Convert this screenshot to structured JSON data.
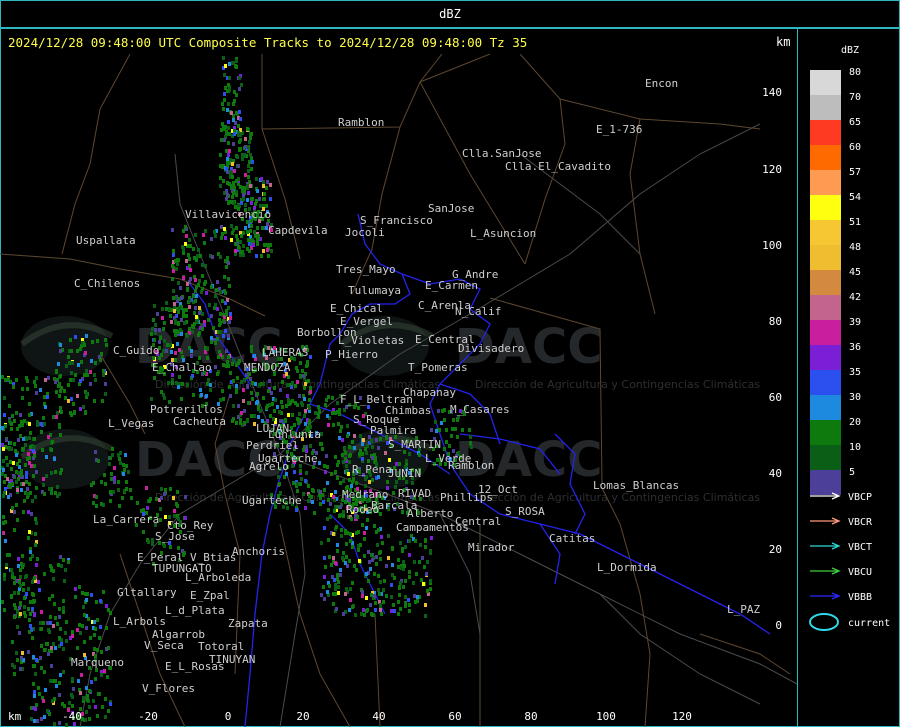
{
  "title": "dBZ",
  "header": {
    "text": "2024/12/28 09:48:00 UTC Composite Tracks to 2024/12/28 09:48:00 Tz 35",
    "km_unit": "km"
  },
  "axes": {
    "x_unit": "km",
    "x_ticks": [
      "-40",
      "-20",
      "0",
      "20",
      "40",
      "60",
      "80",
      "100",
      "120"
    ],
    "y_ticks": [
      "0",
      "20",
      "40",
      "60",
      "80",
      "100",
      "120",
      "140"
    ]
  },
  "legend": {
    "title": "dBZ",
    "scale": [
      {
        "value": "80",
        "color": "#d8d8d8"
      },
      {
        "value": "70",
        "color": "#bdbdbd"
      },
      {
        "value": "65",
        "color": "#ff3a22"
      },
      {
        "value": "60",
        "color": "#ff6a00"
      },
      {
        "value": "57",
        "color": "#ff9a52"
      },
      {
        "value": "54",
        "color": "#ffff10"
      },
      {
        "value": "51",
        "color": "#f7c733"
      },
      {
        "value": "48",
        "color": "#f0bd30"
      },
      {
        "value": "45",
        "color": "#d38a3e"
      },
      {
        "value": "42",
        "color": "#c2648c"
      },
      {
        "value": "39",
        "color": "#c91e9d"
      },
      {
        "value": "36",
        "color": "#7b1fd6"
      },
      {
        "value": "35",
        "color": "#2c4ff0"
      },
      {
        "value": "30",
        "color": "#1e8adf"
      },
      {
        "value": "20",
        "color": "#0e7a0e"
      },
      {
        "value": "10",
        "color": "#0a5e16"
      },
      {
        "value": "5",
        "color": "#4b3f9a"
      }
    ],
    "tracks": [
      {
        "name": "VBCP",
        "color": "#ffffff"
      },
      {
        "name": "VBCR",
        "color": "#ff9a7a"
      },
      {
        "name": "VBCT",
        "color": "#2fd8d8"
      },
      {
        "name": "VBCU",
        "color": "#3fcf3f"
      },
      {
        "name": "VBBB",
        "color": "#2a2aff"
      }
    ],
    "current_label": "current",
    "current_color": "#2fd8e8"
  },
  "watermark": {
    "logo_text": "DACC",
    "subtitle": "Dirección de Agricultura y Contingencias Climáticas"
  },
  "places": [
    "Ramblon",
    "Encon",
    "E_1-736",
    "Clla.SanJose",
    "Clla.El_Cavadito",
    "SanJose",
    "S_Francisco",
    "Jocoli",
    "L_Asuncion",
    "Villavicencio",
    "Capdevila",
    "Uspallata",
    "Tres_Mayo",
    "Tulumaya",
    "G_Andre",
    "E_Carmen",
    "C_Chilenos",
    "E_Chical",
    "E_Vergel",
    "C_Arenla",
    "N_Calif",
    "Borbollon",
    "P_Hierro",
    "L_Violetas",
    "E_Central",
    "Divisadero",
    "C_Guido",
    "E_Challao",
    "LAHERAS",
    "MENDOZA",
    "T_Pomeras",
    "Chapanay",
    "Potrerillos",
    "Cacheuta",
    "L_Vegas",
    "F_L_Beltran",
    "Chimbas",
    "M_Casares",
    "S_Roque",
    "Palmira",
    "S_MARTIN",
    "Perdriel",
    "LUJAN",
    "Lunlunta",
    "Agrelo",
    "R_Pena",
    "JUNIN",
    "L_Verde",
    "Ramblon",
    "12_Oct",
    "Lomas_Blancas",
    "Ugarteche",
    "Medrano",
    "RIVAD",
    "Phillips",
    "Rodeo",
    "Barcala",
    "Alberto",
    "S_ROSA",
    "La_Carrera",
    "Cto_Rey",
    "S_Jose",
    "Campamentos",
    "Central",
    "E_Peral",
    "V_Btias",
    "TUPUNGATO",
    "Anchoris",
    "Mirador",
    "Catitas",
    "L_Dormida",
    "L_Arboleda",
    "Gltallary",
    "E_Zpal",
    "L_d_Plata",
    "L_Arbols",
    "Zapata",
    "Algarrob",
    "V_Seca",
    "Totoral",
    "Marqueno",
    "E_L_Rosas",
    "TINUYAN",
    "V_Flores",
    "L_PAZ",
    "Ugarteche"
  ]
}
